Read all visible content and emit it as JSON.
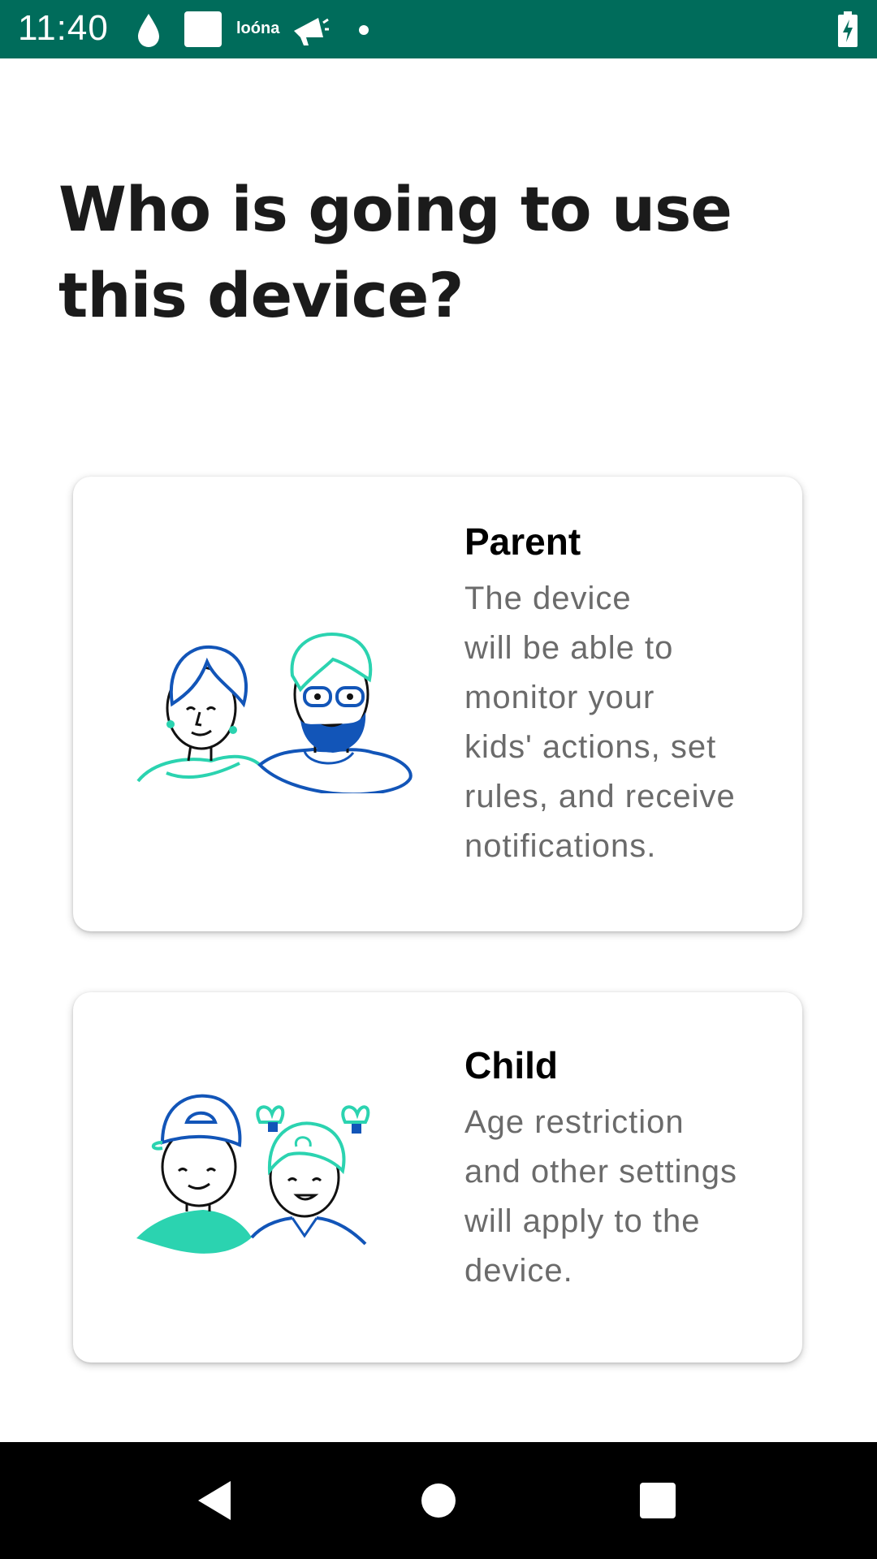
{
  "status_bar": {
    "time": "11:40",
    "brand_text": "loóna",
    "icons": [
      "water-drop-icon",
      "square-notification-icon",
      "loona-app-icon",
      "megaphone-icon",
      "dot-icon",
      "battery-charging-icon"
    ]
  },
  "page": {
    "title_line1": "Who is going to use",
    "title_line2": "this device?"
  },
  "options": {
    "parent": {
      "title": "Parent",
      "desc_lines": [
        "The device",
        "will be able to",
        "monitor your",
        "kids' actions, set",
        "rules, and receive",
        "notifications."
      ]
    },
    "child": {
      "title": "Child",
      "desc_lines": [
        "Age restriction",
        "and other settings",
        "will apply to the",
        "device."
      ]
    }
  },
  "nav_bar": {
    "buttons": [
      "back-icon",
      "home-icon",
      "recents-icon"
    ]
  },
  "colors": {
    "status_bar": "#006C5B",
    "title": "#1b1b1b",
    "body_text": "#6b6b6b",
    "illustration_blue": "#1255B8",
    "illustration_teal": "#2BD3B0"
  }
}
